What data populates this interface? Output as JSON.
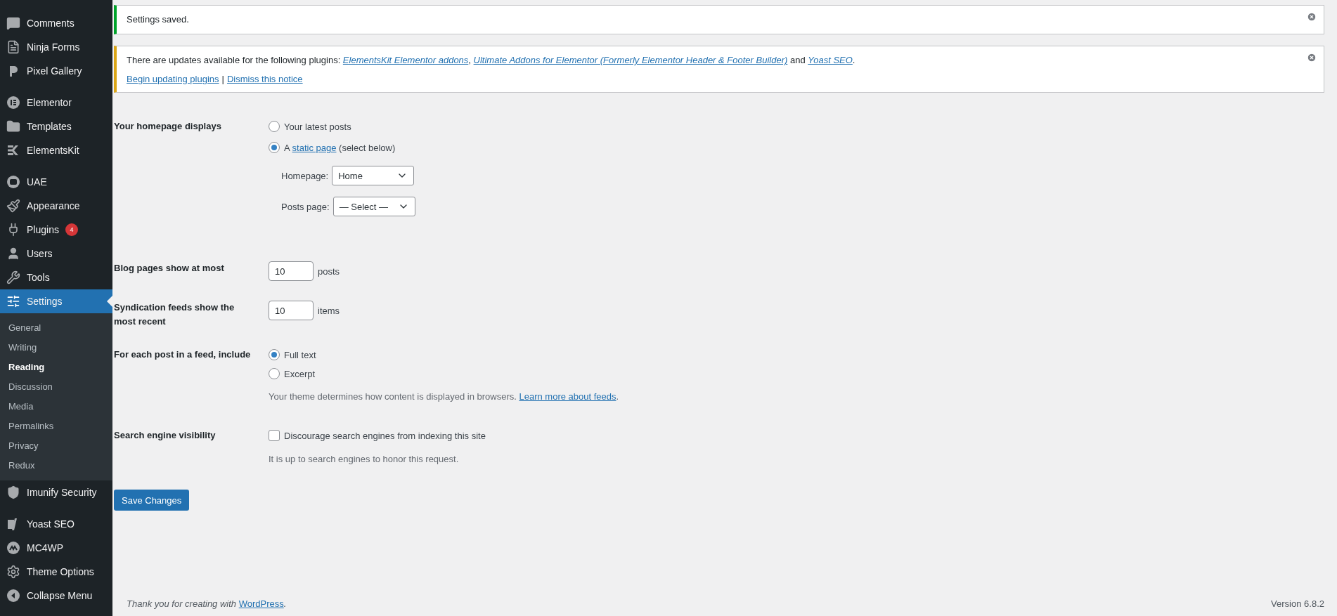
{
  "sidebar": {
    "items": [
      {
        "label": "Comments",
        "selected": false
      },
      {
        "label": "Ninja Forms",
        "selected": false
      },
      {
        "label": "Pixel Gallery",
        "selected": false
      },
      {
        "label": "Elementor",
        "selected": false
      },
      {
        "label": "Templates",
        "selected": false
      },
      {
        "label": "ElementsKit",
        "selected": false
      },
      {
        "label": "UAE",
        "selected": false
      },
      {
        "label": "Appearance",
        "selected": false
      },
      {
        "label": "Plugins",
        "selected": false,
        "badge": "4"
      },
      {
        "label": "Users",
        "selected": false
      },
      {
        "label": "Tools",
        "selected": false
      },
      {
        "label": "Settings",
        "selected": true,
        "children": [
          {
            "label": "General",
            "selected": false
          },
          {
            "label": "Writing",
            "selected": false
          },
          {
            "label": "Reading",
            "selected": true
          },
          {
            "label": "Discussion",
            "selected": false
          },
          {
            "label": "Media",
            "selected": false
          },
          {
            "label": "Permalinks",
            "selected": false
          },
          {
            "label": "Privacy",
            "selected": false
          },
          {
            "label": "Redux",
            "selected": false
          }
        ]
      },
      {
        "label": "Imunify Security",
        "selected": false
      },
      {
        "label": "Yoast SEO",
        "selected": false
      },
      {
        "label": "MC4WP",
        "selected": false
      },
      {
        "label": "Theme Options",
        "selected": false
      },
      {
        "label": "Collapse Menu",
        "selected": false
      }
    ]
  },
  "notices": [
    {
      "kind": "success",
      "text": "Settings saved."
    },
    {
      "kind": "warning",
      "parts": [
        {
          "kind": "text",
          "text": "There are updates available for the following plugins: "
        },
        {
          "kind": "link",
          "text": "ElementsKit Elementor addons"
        },
        {
          "kind": "text",
          "text": ", "
        },
        {
          "kind": "link",
          "text": "Ultimate Addons for Elementor (Formerly Elementor Header & Footer Builder)"
        },
        {
          "kind": "text",
          "text": " and "
        },
        {
          "kind": "link",
          "text": "Yoast SEO"
        },
        {
          "kind": "text",
          "text": "."
        }
      ],
      "actions": [
        "Begin updating plugins",
        "Dismiss this notice"
      ],
      "separator": "|"
    }
  ],
  "form": {
    "homepage": {
      "label": "Your homepage displays",
      "options": [
        {
          "parts": [
            {
              "kind": "text",
              "text": "Your latest posts"
            }
          ],
          "selected": false
        },
        {
          "parts": [
            {
              "kind": "text",
              "text": "A "
            },
            {
              "kind": "link",
              "text": "static page"
            },
            {
              "kind": "text",
              "text": " (select below)"
            }
          ],
          "selected": true
        }
      ],
      "selects": [
        {
          "label": "Homepage:",
          "value": "Home"
        },
        {
          "label": "Posts page:",
          "value": "— Select —"
        }
      ]
    },
    "blog_pages": {
      "label": "Blog pages show at most",
      "value": "10",
      "unit": "posts"
    },
    "syndication": {
      "label": "Syndication feeds show the most recent",
      "value": "10",
      "unit": "items"
    },
    "feed": {
      "label": "For each post in a feed, include",
      "options": [
        {
          "label": "Full text",
          "selected": true
        },
        {
          "label": "Excerpt",
          "selected": false
        }
      ],
      "description": "Your theme determines how content is displayed in browsers. ",
      "link": "Learn more about feeds",
      "end": "."
    },
    "search": {
      "label": "Search engine visibility",
      "checkbox": "Discourage search engines from indexing this site",
      "checked": false,
      "note": "It is up to search engines to honor this request."
    },
    "save": "Save Changes"
  },
  "footer": {
    "thanks": "Thank you for creating with ",
    "link": "WordPress",
    "end": ".",
    "version": "Version 6.8.2"
  }
}
